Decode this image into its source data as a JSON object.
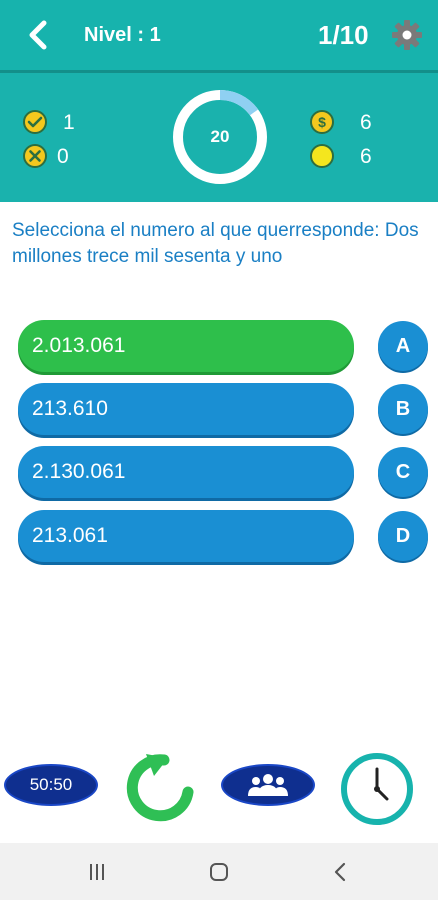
{
  "header": {
    "level_label": "Nivel : 1",
    "progress": "1/10"
  },
  "stats": {
    "correct_count": "1",
    "wrong_count": "0",
    "coins": "6",
    "points": "6",
    "timer": "20",
    "timer_fraction_remaining": 0.85
  },
  "question": "Selecciona el numero al que querresponde: Dos millones trece mil sesenta y uno",
  "answers": [
    {
      "letter": "A",
      "text": "2.013.061",
      "state": "correct"
    },
    {
      "letter": "B",
      "text": "213.610",
      "state": "normal"
    },
    {
      "letter": "C",
      "text": "2.130.061",
      "state": "normal"
    },
    {
      "letter": "D",
      "text": "213.061",
      "state": "normal"
    }
  ],
  "lifelines": {
    "fifty_label": "50:50"
  },
  "colors": {
    "teal": "#17b3ad",
    "answer_blue": "#1a8fd3",
    "correct_green": "#2ebf4b",
    "lifeline_navy": "#0f2f8f"
  }
}
